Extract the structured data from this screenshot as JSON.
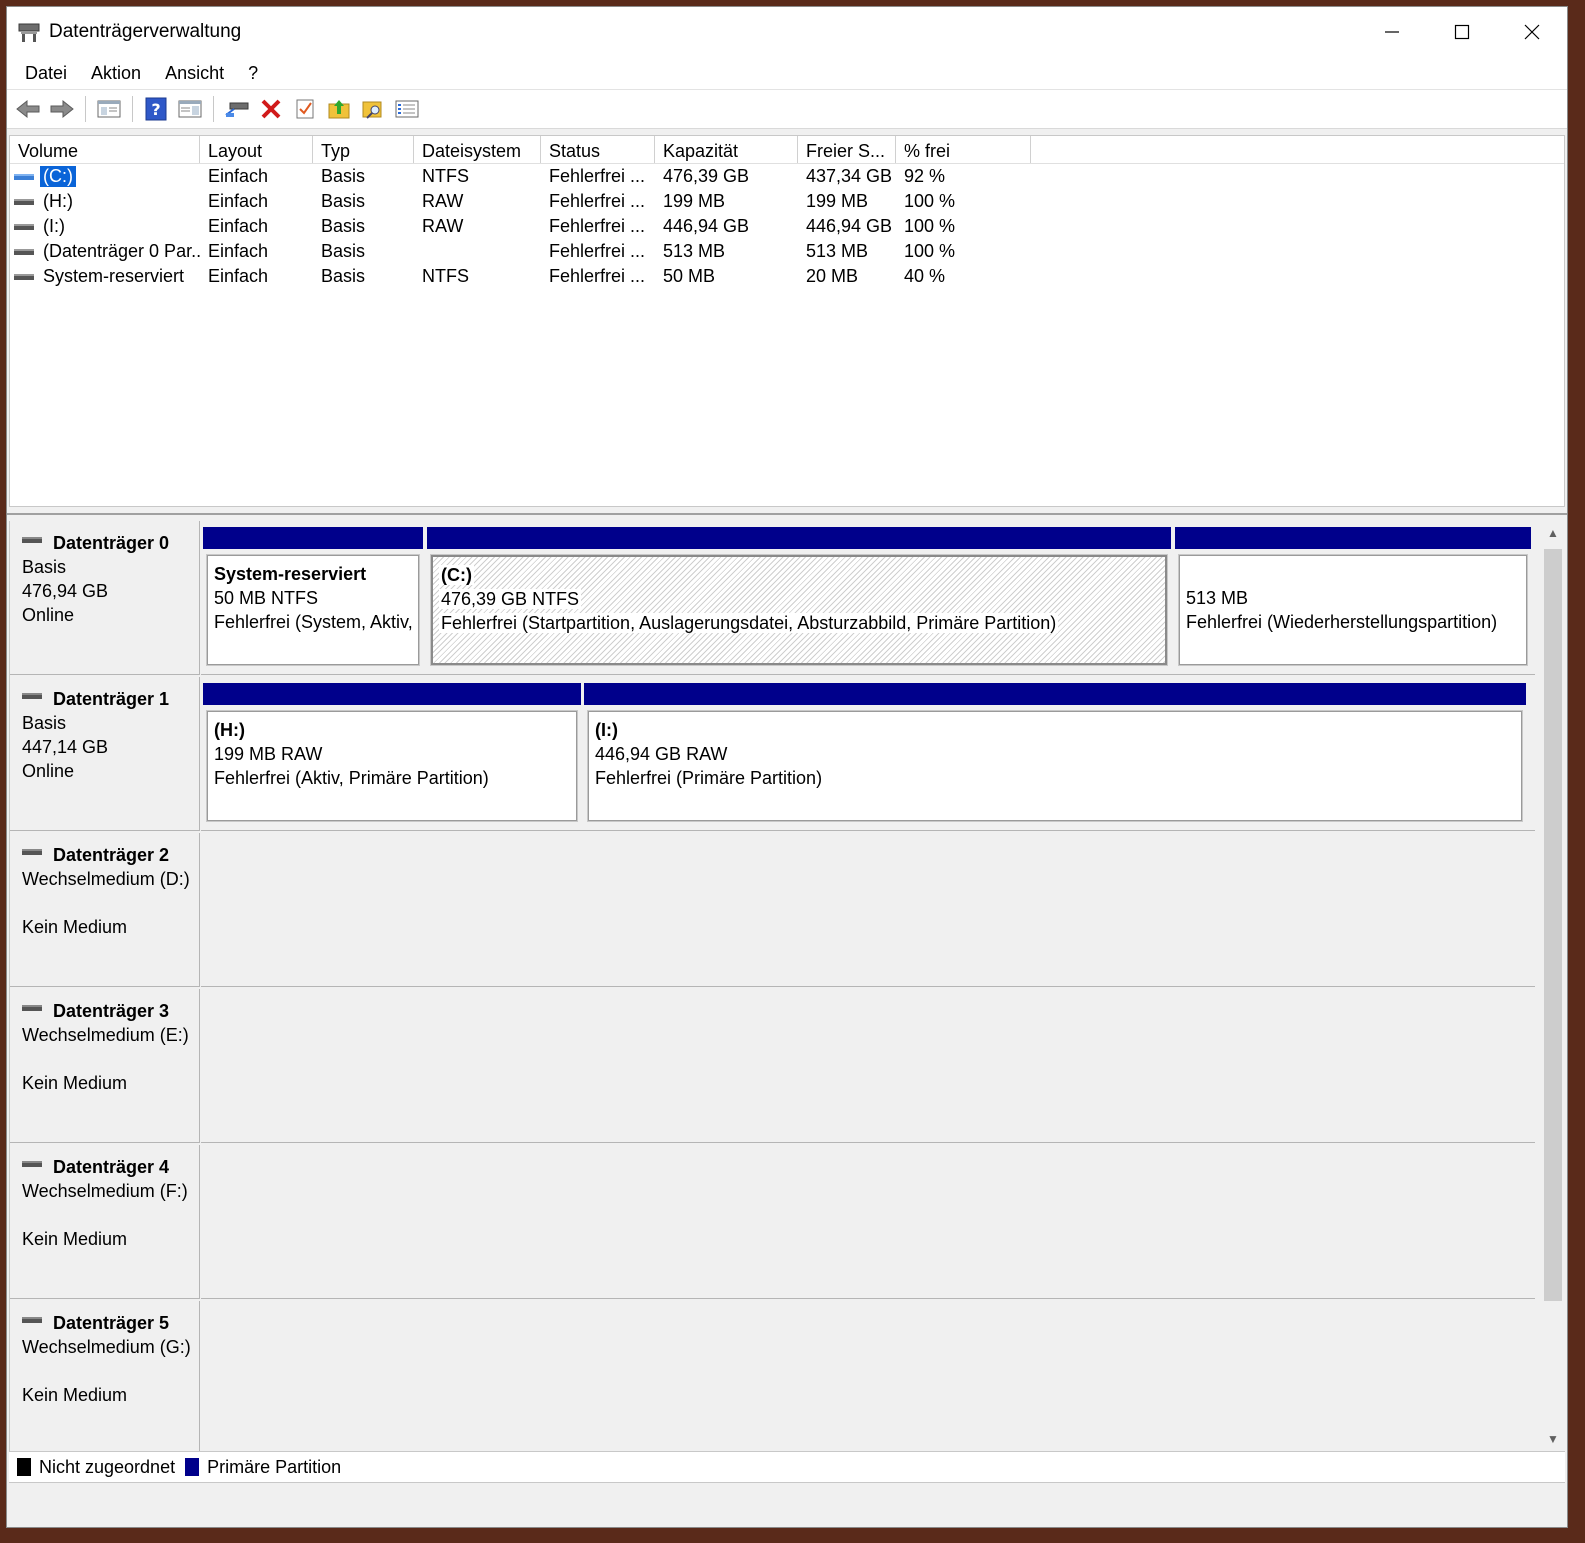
{
  "window": {
    "title": "Datenträgerverwaltung"
  },
  "menu": [
    "Datei",
    "Aktion",
    "Ansicht",
    "?"
  ],
  "toolbar": {
    "icons": [
      "back-arrow-icon",
      "forward-arrow-icon",
      "console-tree-icon",
      "help-icon",
      "properties-icon",
      "connect-disk-icon",
      "delete-icon",
      "check-icon",
      "folder-up-icon",
      "folder-search-icon",
      "list-view-icon"
    ],
    "colors": {
      "delete": "#d11a1a",
      "help": "#2f58c8",
      "folder": "#f0c23a"
    }
  },
  "volume_list": {
    "columns": [
      "Volume",
      "Layout",
      "Typ",
      "Dateisystem",
      "Status",
      "Kapazität",
      "Freier S...",
      "% frei"
    ],
    "rows": [
      {
        "volume": "(C:)",
        "layout": "Einfach",
        "type": "Basis",
        "fs": "NTFS",
        "status": "Fehlerfrei ...",
        "capacity": "476,39 GB",
        "free": "437,34 GB",
        "pct": "92 %",
        "selected": true
      },
      {
        "volume": "(H:)",
        "layout": "Einfach",
        "type": "Basis",
        "fs": "RAW",
        "status": "Fehlerfrei ...",
        "capacity": "199 MB",
        "free": "199 MB",
        "pct": "100 %"
      },
      {
        "volume": "(I:)",
        "layout": "Einfach",
        "type": "Basis",
        "fs": "RAW",
        "status": "Fehlerfrei ...",
        "capacity": "446,94 GB",
        "free": "446,94 GB",
        "pct": "100 %"
      },
      {
        "volume": "(Datenträger 0 Par...",
        "layout": "Einfach",
        "type": "Basis",
        "fs": "",
        "status": "Fehlerfrei ...",
        "capacity": "513 MB",
        "free": "513 MB",
        "pct": "100 %"
      },
      {
        "volume": "System-reserviert",
        "layout": "Einfach",
        "type": "Basis",
        "fs": "NTFS",
        "status": "Fehlerfrei ...",
        "capacity": "50 MB",
        "free": "20 MB",
        "pct": "40 %"
      }
    ]
  },
  "disks": [
    {
      "name": "Datenträger 0",
      "line1": "Basis",
      "line2": "476,94 GB",
      "line3": "Online",
      "partitions": [
        {
          "title": "System-reserviert",
          "l1": "50 MB NTFS",
          "l2": "Fehlerfrei (System, Aktiv,"
        },
        {
          "title": "(C:)",
          "l1": "476,39 GB NTFS",
          "l2": "Fehlerfrei (Startpartition, Auslagerungsdatei, Absturzabbild, Primäre Partition)"
        },
        {
          "title": "",
          "l1": "513 MB",
          "l2": "Fehlerfrei (Wiederherstellungspartition)"
        }
      ]
    },
    {
      "name": "Datenträger 1",
      "line1": "Basis",
      "line2": "447,14 GB",
      "line3": "Online",
      "partitions": [
        {
          "title": "(H:)",
          "l1": "199 MB RAW",
          "l2": "Fehlerfrei (Aktiv, Primäre Partition)"
        },
        {
          "title": "(I:)",
          "l1": "446,94 GB RAW",
          "l2": "Fehlerfrei (Primäre Partition)"
        }
      ]
    },
    {
      "name": "Datenträger 2",
      "line1": "Wechselmedium (D:)",
      "line2": "",
      "line3": "Kein Medium"
    },
    {
      "name": "Datenträger 3",
      "line1": "Wechselmedium (E:)",
      "line2": "",
      "line3": "Kein Medium"
    },
    {
      "name": "Datenträger 4",
      "line1": "Wechselmedium (F:)",
      "line2": "",
      "line3": "Kein Medium"
    },
    {
      "name": "Datenträger 5",
      "line1": "Wechselmedium (G:)",
      "line2": "",
      "line3": "Kein Medium"
    }
  ],
  "legend": [
    {
      "label": "Nicht zugeordnet",
      "color": "#000000"
    },
    {
      "label": "Primäre Partition",
      "color": "#00008b"
    }
  ]
}
